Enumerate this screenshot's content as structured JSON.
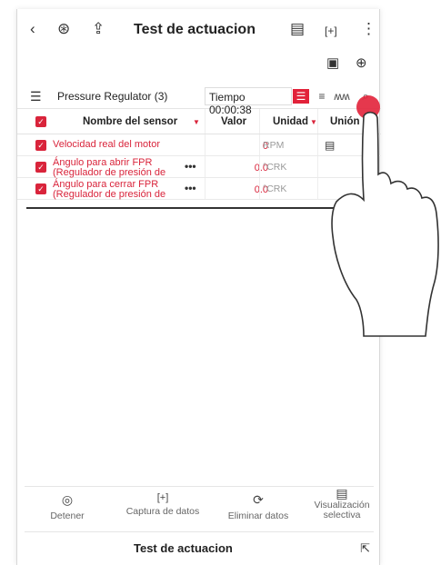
{
  "header": {
    "back_icon": "‹",
    "vci_icon": "⊛",
    "export_icon": "⇪",
    "title": "Test de actuacion",
    "screenshot_icon": "▤",
    "capture_icon": "[+]",
    "menu_icon": "⋮",
    "record_icon": "▣",
    "waveform_icon": "⊕"
  },
  "filterbar": {
    "list_icon": "☰",
    "group_label": "Pressure Regulator (3)",
    "time_label": "Tiempo 00:00:38",
    "view_list_icon": "☰",
    "view_text_icon": "≡",
    "view_graph_icon": "ʍʍ",
    "search_icon": "⌕"
  },
  "table": {
    "columns": {
      "name": "Nombre del sensor",
      "value": "Valor",
      "unit": "Unidad",
      "link": "Unión"
    },
    "rows": [
      {
        "name": "Velocidad real del motor",
        "value": "0",
        "unit": "RPM"
      },
      {
        "name_1": "Ángulo para abrir FPR",
        "name_2": "(Regulador de presión de",
        "more": "•••",
        "value": "0.0",
        "unit": "°CRK"
      },
      {
        "name_1": "Ángulo para cerrar FPR",
        "name_2": "(Regulador de presión de",
        "more": "•••",
        "value": "0.0",
        "unit": "°CRK"
      }
    ]
  },
  "bottombar": {
    "stop_label": "Detener",
    "capture_label": "Captura de datos",
    "clear_label": "Eliminar datos",
    "selective_label_1": "Visualización",
    "selective_label_2": "selectiva"
  },
  "footer": {
    "title": "Test de actuacion"
  },
  "colors": {
    "accent": "#d9243b"
  }
}
